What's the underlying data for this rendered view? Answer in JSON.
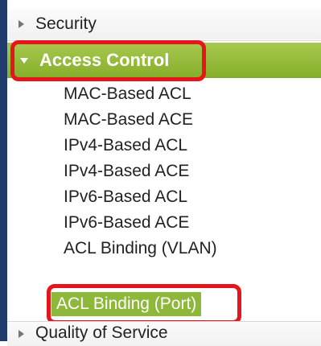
{
  "nav": {
    "security_label": "Security",
    "access_control_label": "Access Control",
    "qos_label": "Quality of Service",
    "sub_items": [
      {
        "label": "MAC-Based ACL"
      },
      {
        "label": "MAC-Based ACE"
      },
      {
        "label": "IPv4-Based ACL"
      },
      {
        "label": "IPv4-Based ACE"
      },
      {
        "label": "IPv6-Based ACL"
      },
      {
        "label": "IPv6-Based ACE"
      },
      {
        "label": "ACL Binding (VLAN)"
      },
      {
        "label": "ACL Binding (Port)"
      }
    ],
    "selected_sub_item": "ACL Binding (Port)"
  },
  "colors": {
    "active_green": "#8db83a",
    "highlight_red": "#e8141b",
    "rail_blue": "#1f3b6b"
  }
}
